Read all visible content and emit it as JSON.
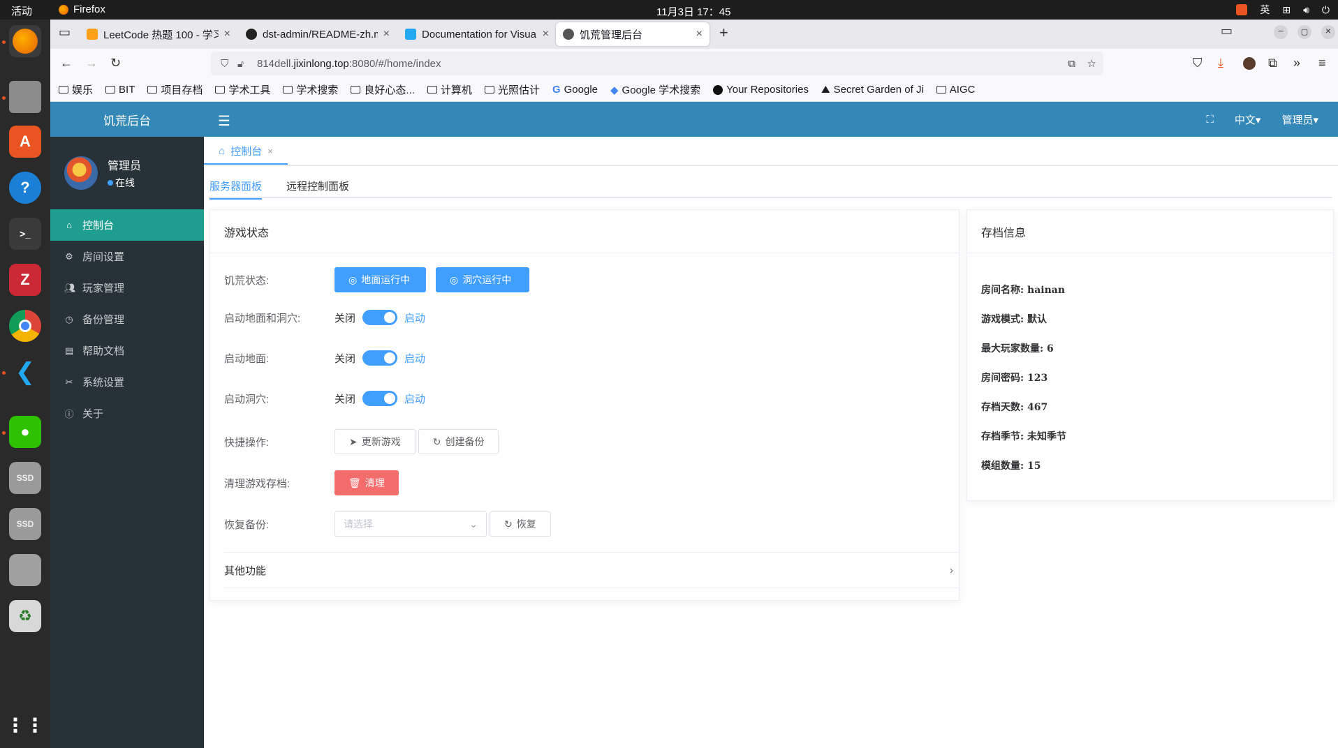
{
  "system": {
    "activities": "活动",
    "app_name": "Firefox",
    "clock": "11月3日  17：45",
    "ime": "英"
  },
  "browser": {
    "tabs": [
      {
        "label": "LeetCode 热题 100 - 学习"
      },
      {
        "label": "dst-admin/README-zh.m"
      },
      {
        "label": "Documentation for Visua"
      },
      {
        "label": "饥荒管理后台"
      }
    ],
    "url_prefix": "814dell.",
    "url_host": "jixinlong.top",
    "url_path": ":8080/#/home/index",
    "bookmarks": [
      {
        "label": "娱乐",
        "icon": "folder-icon"
      },
      {
        "label": "BIT",
        "icon": "folder-icon"
      },
      {
        "label": "项目存档",
        "icon": "folder-icon"
      },
      {
        "label": "学术工具",
        "icon": "folder-icon"
      },
      {
        "label": "学术搜索",
        "icon": "folder-icon"
      },
      {
        "label": "良好心态...",
        "icon": "folder-icon"
      },
      {
        "label": "计算机",
        "icon": "folder-icon"
      },
      {
        "label": "光照估计",
        "icon": "folder-icon"
      },
      {
        "label": "Google",
        "icon": "google-icon"
      },
      {
        "label": "Google 学术搜索",
        "icon": "scholar-icon"
      },
      {
        "label": "Your Repositories",
        "icon": "github-icon"
      },
      {
        "label": "Secret Garden of Ji",
        "icon": "site-icon"
      },
      {
        "label": "AIGC",
        "icon": "folder-icon"
      }
    ]
  },
  "app": {
    "logo": "饥荒后台",
    "user": {
      "name": "管理员",
      "status": "在线"
    },
    "menu": [
      {
        "label": "控制台",
        "icon": "home-icon"
      },
      {
        "label": "房间设置",
        "icon": "gear-icon"
      },
      {
        "label": "玩家管理",
        "icon": "users-icon"
      },
      {
        "label": "备份管理",
        "icon": "clock-icon"
      },
      {
        "label": "帮助文档",
        "icon": "doc-icon"
      },
      {
        "label": "系统设置",
        "icon": "tools-icon"
      },
      {
        "label": "关于",
        "icon": "info-icon"
      }
    ],
    "header": {
      "lang": "中文",
      "user": "管理员"
    },
    "tag": "控制台",
    "subtabs": [
      "服务器面板",
      "远程控制面板"
    ]
  },
  "game_status": {
    "title": "游戏状态",
    "status_label": "饥荒状态:",
    "ground_running": "地面运行中",
    "cave_running": "洞穴运行中",
    "switches": [
      {
        "label": "启动地面和洞穴:",
        "off": "关闭",
        "on": "启动"
      },
      {
        "label": "启动地面:",
        "off": "关闭",
        "on": "启动"
      },
      {
        "label": "启动洞穴:",
        "off": "关闭",
        "on": "启动"
      }
    ],
    "quick_label": "快捷操作:",
    "update_btn": "更新游戏",
    "backup_btn": "创建备份",
    "clean_label": "清理游戏存档:",
    "clean_btn": "清理",
    "restore_label": "恢复备份:",
    "restore_placeholder": "请选择",
    "restore_btn": "恢复",
    "other": "其他功能"
  },
  "archive": {
    "title": "存档信息",
    "rows": [
      "房间名称:  hainan",
      "游戏模式:  默认",
      "最大玩家数量:  6",
      "房间密码:  123",
      "存档天数:  467",
      "存档季节:  未知季节",
      "模组数量:  15"
    ]
  }
}
